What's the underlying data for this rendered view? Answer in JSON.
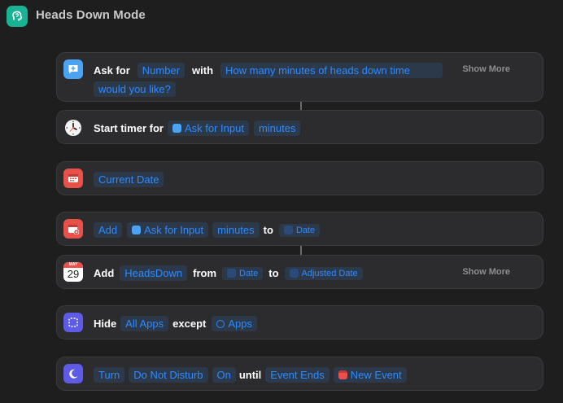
{
  "app": {
    "title": "Heads Down Mode"
  },
  "actions": [
    {
      "icon": "ask-for-input-icon",
      "verb": "Ask for",
      "type": "Number",
      "with": "with",
      "prompt_line1": "How many minutes of heads down time",
      "prompt_line2": "would you like?",
      "show_more": "Show More"
    },
    {
      "icon": "clock-icon",
      "verb": "Start timer for",
      "var": "Ask for Input",
      "unit": "minutes"
    },
    {
      "icon": "calendar-icon",
      "value": "Current Date"
    },
    {
      "icon": "calendar-add-icon",
      "verb": "Add",
      "var": "Ask for Input",
      "unit": "minutes",
      "to": "to",
      "target": "Date"
    },
    {
      "icon": "calendar-29-icon",
      "verb": "Add",
      "name": "HeadsDown",
      "from": "from",
      "start": "Date",
      "to": "to",
      "end": "Adjusted Date",
      "show_more": "Show More",
      "cal_month": "MAY",
      "cal_day": "29"
    },
    {
      "icon": "dotted-square-icon",
      "verb": "Hide",
      "target": "All Apps",
      "except": "except",
      "apps": "Apps"
    },
    {
      "icon": "moon-icon",
      "verb": "Turn",
      "mode": "Do Not Disturb",
      "state": "On",
      "until": "until",
      "condition": "Event Ends",
      "event": "New Event"
    }
  ],
  "colors": {
    "accent": "#2e8bff",
    "app_icon": "#19b294",
    "blue_icon": "#4ba3f2",
    "red_icon": "#e8504a",
    "purple_icon": "#5e5ce6"
  }
}
